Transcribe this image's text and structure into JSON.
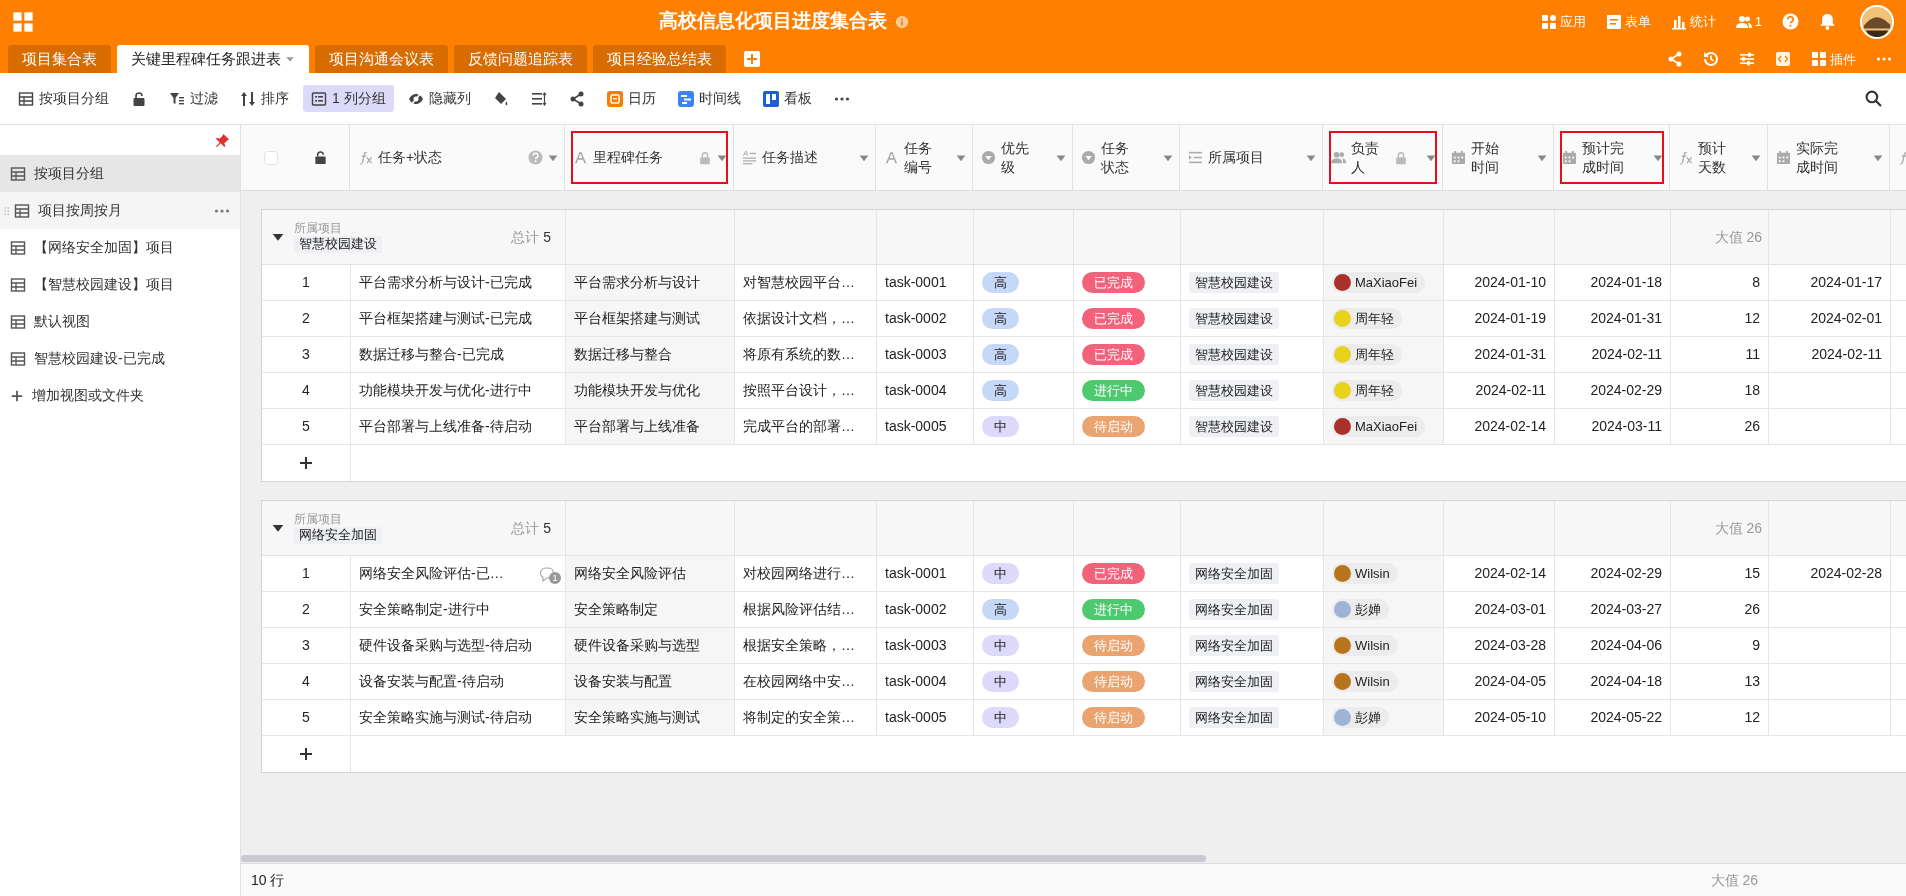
{
  "app": {
    "title": "高校信息化项目进度集合表",
    "actions": [
      {
        "kind": "apps",
        "label": "应用"
      },
      {
        "kind": "form",
        "label": "表单"
      },
      {
        "kind": "chart",
        "label": "统计"
      },
      {
        "kind": "people",
        "label": "1"
      }
    ]
  },
  "tabs": [
    {
      "label": "项目集合表",
      "selected": false
    },
    {
      "label": "关键里程碑任务跟进表",
      "selected": true
    },
    {
      "label": "项目沟通会议表",
      "selected": false
    },
    {
      "label": "反馈问题追踪表",
      "selected": false
    },
    {
      "label": "项目经验总结表",
      "selected": false
    }
  ],
  "tab_actions": [
    {
      "kind": "plugin",
      "label": "插件"
    }
  ],
  "toolbar": [
    {
      "kind": "table",
      "label": "按项目分组",
      "active": false
    },
    {
      "kind": "lock",
      "active": false
    },
    {
      "kind": "filter",
      "label": "过滤",
      "active": false
    },
    {
      "kind": "sort",
      "label": "排序",
      "active": false
    },
    {
      "kind": "group",
      "label": "1 列分组",
      "active": true
    },
    {
      "kind": "hide",
      "label": "隐藏列",
      "active": false
    },
    {
      "kind": "bucket",
      "active": false
    },
    {
      "kind": "rowheight",
      "active": false
    },
    {
      "kind": "share",
      "active": false
    },
    {
      "kind": "calendar",
      "label": "日历",
      "active": false
    },
    {
      "kind": "timeline",
      "label": "时间线",
      "active": false
    },
    {
      "kind": "kanban",
      "label": "看板",
      "active": false
    },
    {
      "kind": "more",
      "active": false
    }
  ],
  "sidebar": {
    "items": [
      {
        "label": "按项目分组",
        "selected": true,
        "hovered": false
      },
      {
        "label": "项目按周按月",
        "selected": false,
        "hovered": true
      },
      {
        "label": "【网络安全加固】项目",
        "selected": false,
        "hovered": false
      },
      {
        "label": "【智慧校园建设】项目",
        "selected": false,
        "hovered": false
      },
      {
        "label": "默认视图",
        "selected": false,
        "hovered": false
      },
      {
        "label": "智慧校园建设-已完成",
        "selected": false,
        "hovered": false
      }
    ],
    "add_label": "增加视图或文件夹"
  },
  "columns": [
    {
      "label": "任务+状态",
      "kind": "formula",
      "help": true,
      "locked": false,
      "highlighted": false
    },
    {
      "label": "里程碑任务",
      "kind": "text",
      "help": false,
      "locked": true,
      "highlighted": true
    },
    {
      "label": "任务描述",
      "kind": "longtext",
      "help": false,
      "locked": false,
      "highlighted": false
    },
    {
      "label": "任务编号",
      "kind": "text",
      "help": false,
      "locked": false,
      "highlighted": false
    },
    {
      "label": "优先级",
      "kind": "select",
      "help": false,
      "locked": false,
      "highlighted": false
    },
    {
      "label": "任务状态",
      "kind": "select",
      "help": false,
      "locked": false,
      "highlighted": false
    },
    {
      "label": "所属项目",
      "kind": "list",
      "help": false,
      "locked": false,
      "highlighted": false
    },
    {
      "label": "负责人",
      "kind": "people",
      "help": false,
      "locked": true,
      "highlighted": true
    },
    {
      "label": "开始时间",
      "kind": "date",
      "help": false,
      "locked": false,
      "highlighted": false
    },
    {
      "label": "预计完成时间",
      "kind": "date",
      "help": false,
      "locked": false,
      "highlighted": true
    },
    {
      "label": "预计天数",
      "kind": "formula",
      "help": false,
      "locked": false,
      "highlighted": false
    },
    {
      "label": "实际完成时间",
      "kind": "date",
      "help": false,
      "locked": false,
      "highlighted": false
    },
    {
      "kind": "formula"
    }
  ],
  "select_all": {
    "checked": false
  },
  "groups": [
    {
      "field_label": "所属项目",
      "value": "智慧校园建设",
      "total_label": "总计",
      "total": "5",
      "summary": "大值 26",
      "rows": [
        {
          "index": "1",
          "task_status": "平台需求分析与设计-已完成",
          "milestone": "平台需求分析与设计",
          "description": "对智慧校园平台…",
          "task_id": "task-0001",
          "priority": {
            "text": "高",
            "color": "#c6d8f8"
          },
          "status": {
            "text": "已完成",
            "color": "#f2637b"
          },
          "project": "智慧校园建设",
          "owner": {
            "name": "MaXiaoFei",
            "color": "#a8322a"
          },
          "start": "2024-01-10",
          "due": "2024-01-18",
          "days": "8",
          "actual": "2024-01-17"
        },
        {
          "index": "2",
          "task_status": "平台框架搭建与测试-已完成",
          "milestone": "平台框架搭建与测试",
          "description": "依据设计文档，…",
          "task_id": "task-0002",
          "priority": {
            "text": "高",
            "color": "#c6d8f8"
          },
          "status": {
            "text": "已完成",
            "color": "#f2637b"
          },
          "project": "智慧校园建设",
          "owner": {
            "name": "周年轻",
            "color": "#e8d21e"
          },
          "start": "2024-01-19",
          "due": "2024-01-31",
          "days": "12",
          "actual": "2024-02-01"
        },
        {
          "index": "3",
          "task_status": "数据迁移与整合-已完成",
          "milestone": "数据迁移与整合",
          "description": "将原有系统的数…",
          "task_id": "task-0003",
          "priority": {
            "text": "高",
            "color": "#c6d8f8"
          },
          "status": {
            "text": "已完成",
            "color": "#f2637b"
          },
          "project": "智慧校园建设",
          "owner": {
            "name": "周年轻",
            "color": "#e8d21e"
          },
          "start": "2024-01-31",
          "due": "2024-02-11",
          "days": "11",
          "actual": "2024-02-11"
        },
        {
          "index": "4",
          "task_status": "功能模块开发与优化-进行中",
          "milestone": "功能模块开发与优化",
          "description": "按照平台设计，…",
          "task_id": "task-0004",
          "priority": {
            "text": "高",
            "color": "#c6d8f8"
          },
          "status": {
            "text": "进行中",
            "color": "#4ec96f"
          },
          "project": "智慧校园建设",
          "owner": {
            "name": "周年轻",
            "color": "#e8d21e"
          },
          "start": "2024-02-11",
          "due": "2024-02-29",
          "days": "18"
        },
        {
          "index": "5",
          "task_status": "平台部署与上线准备-待启动",
          "milestone": "平台部署与上线准备",
          "description": "完成平台的部署…",
          "task_id": "task-0005",
          "priority": {
            "text": "中",
            "color": "#ddd9fb"
          },
          "status": {
            "text": "待启动",
            "color": "#eaa470"
          },
          "project": "智慧校园建设",
          "owner": {
            "name": "MaXiaoFei",
            "color": "#a8322a"
          },
          "start": "2024-02-14",
          "due": "2024-03-11",
          "days": "26"
        }
      ]
    },
    {
      "field_label": "所属项目",
      "value": "网络安全加固",
      "total_label": "总计",
      "total": "5",
      "summary": "大值 26",
      "rows": [
        {
          "index": "1",
          "task_status": "网络安全风险评估-已…",
          "comments": "1",
          "milestone": "网络安全风险评估",
          "description": "对校园网络进行…",
          "task_id": "task-0001",
          "priority": {
            "text": "中",
            "color": "#ddd9fb"
          },
          "status": {
            "text": "已完成",
            "color": "#f2637b"
          },
          "project": "网络安全加固",
          "owner": {
            "name": "Wilsin",
            "color": "#b8741c"
          },
          "start": "2024-02-14",
          "due": "2024-02-29",
          "days": "15",
          "actual": "2024-02-28"
        },
        {
          "index": "2",
          "task_status": "安全策略制定-进行中",
          "milestone": "安全策略制定",
          "description": "根据风险评估结…",
          "task_id": "task-0002",
          "priority": {
            "text": "高",
            "color": "#c6d8f8"
          },
          "status": {
            "text": "进行中",
            "color": "#4ec96f"
          },
          "project": "网络安全加固",
          "owner": {
            "name": "彭婵",
            "color": "#9fb3d6"
          },
          "start": "2024-03-01",
          "due": "2024-03-27",
          "days": "26"
        },
        {
          "index": "3",
          "task_status": "硬件设备采购与选型-待启动",
          "milestone": "硬件设备采购与选型",
          "description": "根据安全策略，…",
          "task_id": "task-0003",
          "priority": {
            "text": "中",
            "color": "#ddd9fb"
          },
          "status": {
            "text": "待启动",
            "color": "#eaa470"
          },
          "project": "网络安全加固",
          "owner": {
            "name": "Wilsin",
            "color": "#b8741c"
          },
          "start": "2024-03-28",
          "due": "2024-04-06",
          "days": "9"
        },
        {
          "index": "4",
          "task_status": "设备安装与配置-待启动",
          "milestone": "设备安装与配置",
          "description": "在校园网络中安…",
          "task_id": "task-0004",
          "priority": {
            "text": "中",
            "color": "#ddd9fb"
          },
          "status": {
            "text": "待启动",
            "color": "#eaa470"
          },
          "project": "网络安全加固",
          "owner": {
            "name": "Wilsin",
            "color": "#b8741c"
          },
          "start": "2024-04-05",
          "due": "2024-04-18",
          "days": "13"
        },
        {
          "index": "5",
          "task_status": "安全策略实施与测试-待启动",
          "milestone": "安全策略实施与测试",
          "description": "将制定的安全策…",
          "task_id": "task-0005",
          "priority": {
            "text": "中",
            "color": "#ddd9fb"
          },
          "status": {
            "text": "待启动",
            "color": "#eaa470"
          },
          "project": "网络安全加固",
          "owner": {
            "name": "彭婵",
            "color": "#9fb3d6"
          },
          "start": "2024-05-10",
          "due": "2024-05-22",
          "days": "12"
        }
      ]
    }
  ],
  "footer": {
    "count": "10 行",
    "summary": "大值 26"
  }
}
